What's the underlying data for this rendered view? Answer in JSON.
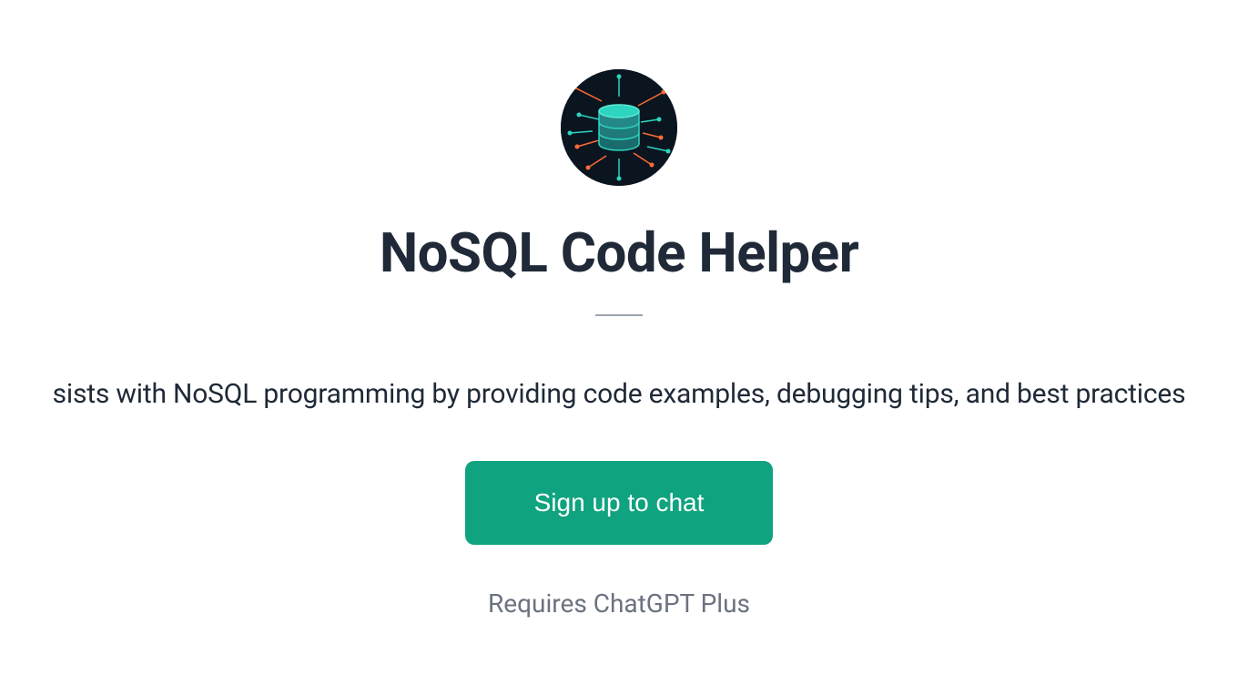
{
  "avatar": {
    "name": "database-circuit-icon"
  },
  "title": "NoSQL Code Helper",
  "description": "sists with NoSQL programming by providing code examples, debugging tips, and best practices",
  "button": {
    "label": "Sign up to chat"
  },
  "footer": {
    "requires": "Requires ChatGPT Plus"
  }
}
